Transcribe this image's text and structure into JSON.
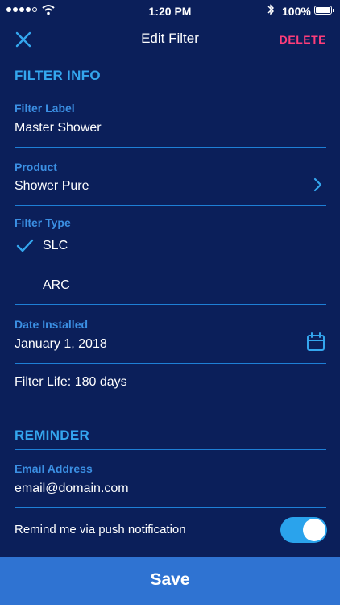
{
  "status_bar": {
    "time": "1:20 PM",
    "battery": "100%",
    "signal_bars_filled": 4,
    "signal_bars_total": 5,
    "icons": [
      "signal-icon",
      "wifi-icon",
      "bluetooth-icon",
      "battery-icon"
    ]
  },
  "nav": {
    "title": "Edit Filter",
    "delete_label": "DELETE",
    "close_icon": "close-icon"
  },
  "filter_info": {
    "section_title": "FILTER INFO",
    "label_field": {
      "label": "Filter Label",
      "value": "Master Shower"
    },
    "product_field": {
      "label": "Product",
      "value": "Shower Pure",
      "icon": "chevron-right-icon"
    },
    "filter_type": {
      "label": "Filter Type",
      "options": [
        {
          "label": "SLC",
          "selected": true
        },
        {
          "label": "ARC",
          "selected": false
        }
      ]
    },
    "date_field": {
      "label": "Date Installed",
      "value": "January 1, 2018",
      "icon": "calendar-icon"
    },
    "filter_life": "Filter Life: 180 days"
  },
  "reminder": {
    "section_title": "REMINDER",
    "email_field": {
      "label": "Email Address",
      "value": "email@domain.com"
    },
    "push_label": "Remind me via push notification",
    "push_enabled": true
  },
  "save_label": "Save",
  "colors": {
    "background": "#0b1f5a",
    "accent": "#34a6ee",
    "divider": "#1e7fd6",
    "delete": "#ff3d7a",
    "save_bar": "#2f73d2",
    "toggle_on": "#2aa3ec"
  }
}
